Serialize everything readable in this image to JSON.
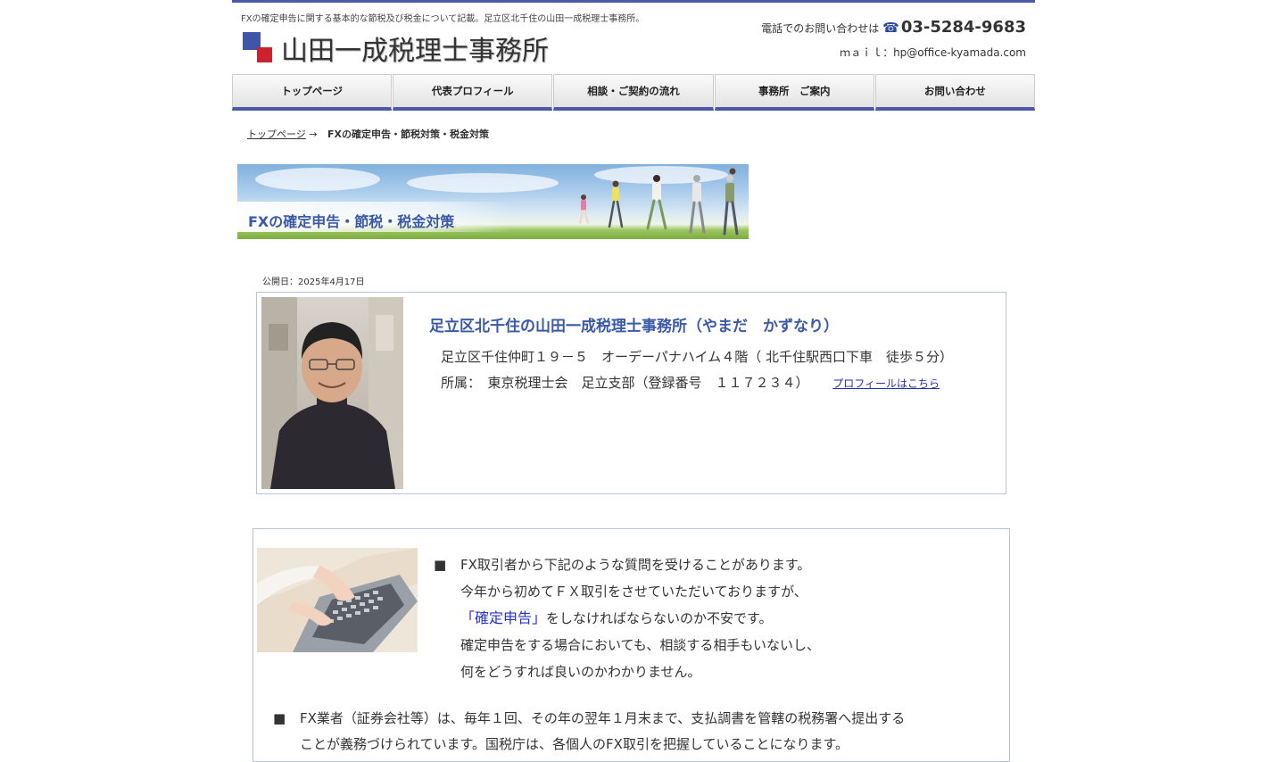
{
  "header": {
    "tagline": "FXの確定申告に関する基本的な節税及び税金について記載。足立区北千住の山田一成税理士事務所。",
    "site_title": "山田一成税理士事務所",
    "phone_label": "電話でのお問い合わせは",
    "phone_icon": "☎",
    "phone_number": "03-5284-9683",
    "mail_line": "ｍａｉｌ：hp@office-kyamada.com"
  },
  "nav": {
    "items": [
      "トップページ",
      "代表プロフィール",
      "相談・ご契約の流れ",
      "事務所　ご案内",
      "お問い合わせ"
    ]
  },
  "breadcrumb": {
    "home": "トップページ",
    "arrow": "→",
    "current": "FXの確定申告・節税対策・税金対策"
  },
  "banner": {
    "title": "FXの確定申告・節税・税金対策"
  },
  "publish_date": "公開日：2025年4月17日",
  "profile": {
    "name": "足立区北千住の山田一成税理士事務所（やまだ　かずなり）",
    "address": "足立区千住仲町１９－５　オーデーパナハイム４階（ 北千住駅西口下車　徒歩５分）",
    "affiliation": "所属：　東京税理士会　足立支部（登録番号　１１７２３４）",
    "profile_link": "プロフィールはこちら"
  },
  "content": {
    "bullet": "■",
    "q1": "FX取引者から下記のような質問を受けることがあります。",
    "q2": "今年から初めてＦＸ取引をさせていただいておりますが、",
    "q3_highlight": "「確定申告」",
    "q3_rest": "をしなければならないのか不安です。",
    "q4": "確定申告をする場合においても、相談する相手もいないし、",
    "q5": "何をどうすれば良いのかわかりません。",
    "p2_line1": "FX業者（証券会社等）は、毎年１回、その年の翌年１月末まで、支払調書を管轄の税務署へ提出する",
    "p2_line2": "ことが義務づけられています。国税庁は、各個人のFX取引を把握していることになります。"
  },
  "colors": {
    "accent": "#4a5aa8",
    "logo_blue": "#4054a8",
    "logo_red": "#cc2230",
    "heading_blue": "#3a5aa8",
    "link": "#2233aa"
  }
}
